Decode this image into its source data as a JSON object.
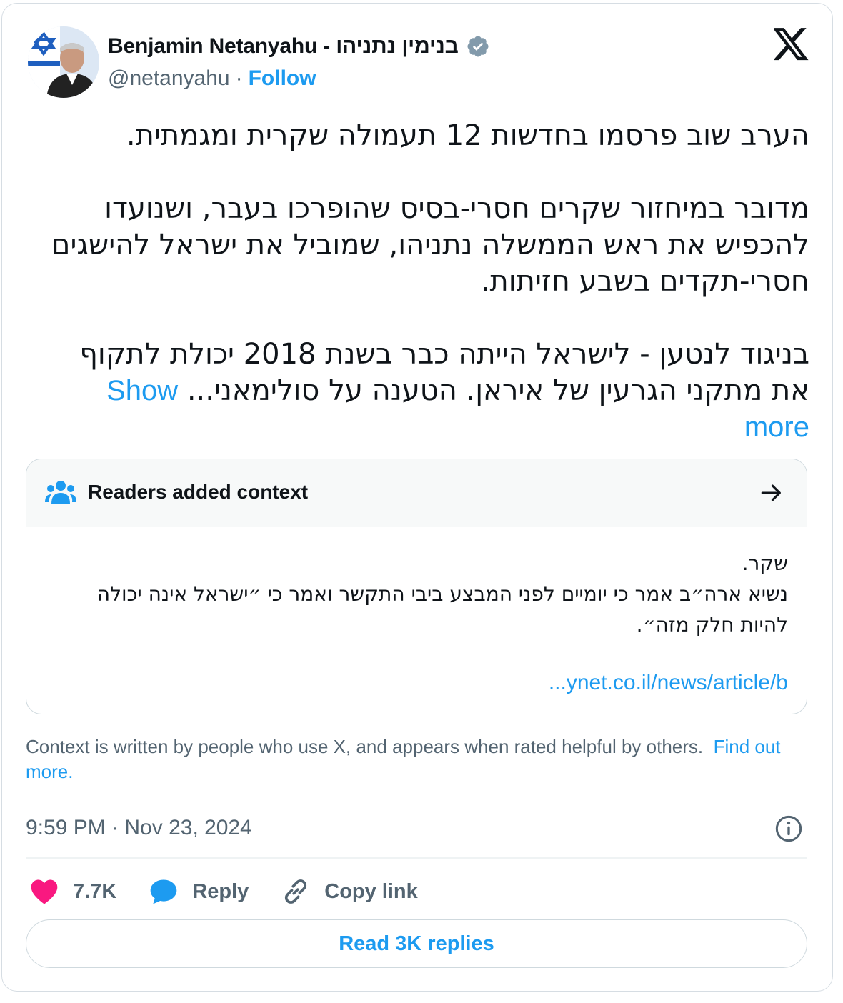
{
  "author": {
    "display_name": "Benjamin Netanyahu - בנימין נתניהו",
    "handle": "@netanyahu",
    "separator": "·",
    "follow_label": "Follow",
    "verified_color": "#829aab"
  },
  "tweet": {
    "paragraphs": [
      "הערב שוב פרסמו בחדשות 12 תעמולה שקרית ומגמתית.",
      "מדובר במיחזור שקרים חסרי-בסיס שהופרכו בעבר, ושנועדו להכפיש את ראש הממשלה נתניהו, שמוביל את ישראל להישגים חסרי-תקדים בשבע חזיתות.",
      "בניגוד לנטען - לישראל הייתה כבר בשנת 2018 יכולת לתקוף את מתקני הגרעין של איראן. הטענה על סולימאני..."
    ],
    "show_more_label": "Show more"
  },
  "community_note": {
    "title": "Readers added context",
    "lines": [
      "שקר.",
      "נשיא ארה״ב אמר כי יומיים לפני המבצע ביבי התקשר ואמר כי ״ישראל אינה יכולה להיות חלק מזה״."
    ],
    "link_text": "...ynet.co.il/news/article/b"
  },
  "context_footer": {
    "text": "Context is written by people who use X, and appears when rated helpful by others.",
    "link_label": "Find out more."
  },
  "timestamp": "9:59 PM · Nov 23, 2024",
  "actions": {
    "likes": "7.7K",
    "reply_label": "Reply",
    "copy_link_label": "Copy link"
  },
  "read_replies_label": "Read 3K replies",
  "colors": {
    "accent": "#1d9bf0",
    "like": "#f91880",
    "text": "#0f1419",
    "muted": "#536471"
  }
}
